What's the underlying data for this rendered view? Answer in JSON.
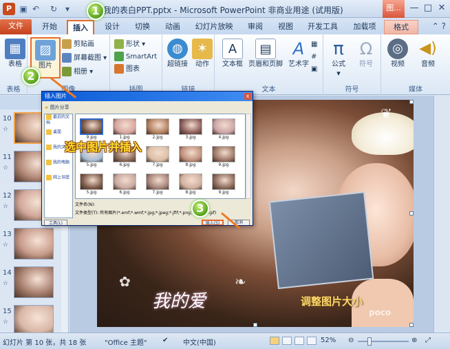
{
  "titlebar": {
    "title": "我的表白PPT.pptx - Microsoft PowerPoint 非商业用途 (试用版)",
    "context_tab_group": "图...",
    "logo": "P",
    "buttons": {
      "minimize": "—",
      "maximize": "□",
      "close": "✕"
    }
  },
  "tabs": {
    "file": "文件",
    "items": [
      "开始",
      "插入",
      "设计",
      "切换",
      "动画",
      "幻灯片放映",
      "审阅",
      "视图",
      "开发工具",
      "加载项",
      "格式"
    ],
    "active": "插入"
  },
  "ribbon": {
    "groups": {
      "tables": "表格",
      "images": "图像",
      "illustrations": "插图",
      "links": "链接",
      "text": "文本",
      "symbols": "符号",
      "media": "媒体"
    },
    "buttons": {
      "table": "表格",
      "picture": "图片",
      "clipart": "剪贴画",
      "screenshot": "屏幕截图",
      "album": "相册",
      "shapes": "形状",
      "smartart": "SmartArt",
      "chart": "图表",
      "hyperlink": "超链接",
      "action": "动作",
      "textbox": "文本框",
      "header_footer": "页眉和页脚",
      "wordart": "艺术字",
      "equation": "公式",
      "symbol": "符号",
      "video": "视频",
      "audio": "音频"
    }
  },
  "slides_pane": {
    "slides": [
      {
        "num": "10",
        "active": true
      },
      {
        "num": "11",
        "active": false
      },
      {
        "num": "12",
        "active": false
      },
      {
        "num": "13",
        "active": false
      },
      {
        "num": "14",
        "active": false
      },
      {
        "num": "15",
        "active": false
      }
    ]
  },
  "dialog": {
    "title": "插入图片",
    "address": "图片分享",
    "close": "x",
    "places": [
      "最近的文档",
      "桌面",
      "我的文档",
      "我的电脑",
      "网上邻居"
    ],
    "files": [
      "9.jpg",
      "1.jpg",
      "2.jpg",
      "3.jpg",
      "4.jpg",
      "5.jpg",
      "6.jpg",
      "7.jpg",
      "8.jpg",
      "9.jpg",
      "5.jpg",
      "6.jpg",
      "7.jpg",
      "8.jpg",
      "9.jpg"
    ],
    "filename_label": "文件名(N):",
    "filetype_label": "文件类型(T):",
    "filetype_value": "所有图片(*.emf;*.wmf;*.jpg;*.jpeg;*.jfif;*.png;*.bmp;*.gif)",
    "tools": "工具(L)",
    "insert": "插入(S)",
    "cancel": "取消"
  },
  "annotations": {
    "step1": "1",
    "step2": "2",
    "step3": "3",
    "select_insert": "选中图片并插入",
    "resize": "调整图片大小"
  },
  "slide": {
    "love_text": "我的爱",
    "watermark": "poco"
  },
  "statusbar": {
    "slide_info": "幻灯片 第 10 张，共 18 张",
    "theme": "\"Office 主题\"",
    "language": "中文(中国)",
    "zoom": "52%"
  },
  "colors": {
    "accent_orange": "#e66b2c",
    "file_tab": "#c4421c",
    "step_green": "#55a21a",
    "caption_yellow": "#ffdd2c"
  }
}
